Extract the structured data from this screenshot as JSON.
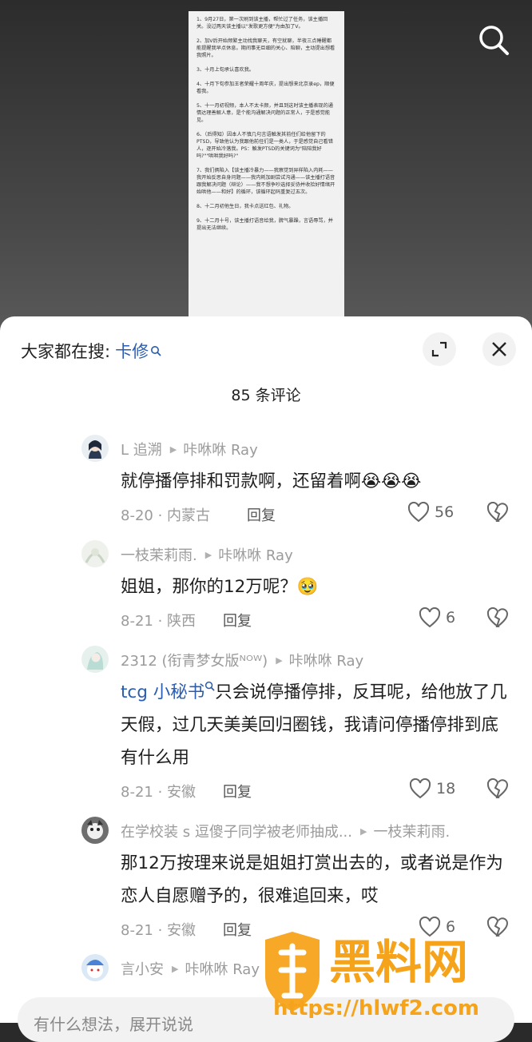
{
  "doc": {
    "paragraphs": [
      "1、9月27日，第一次刷到该主播，帮忙过了任务，该主播回关。没过两天该主播以\"发歌更方便\"为由加了V。",
      "2、加V后开始频繁主动找我聊天，有空就聊，半夜三点睡醒都能提醒我早点休息。期间事无巨细的关心、陪聊，主动提出想看我照片。",
      "3、十月上旬承认喜欢我。",
      "4、十月下旬参加王者荣耀十周年庆，提出想来北京录ep，顺便看我。",
      "5、十一月初视频，本人不太卡颜，并且到这时该主播表现的通情达理善解人意，是个能沟通解决问题的正常人，于是感觉能见。",
      "6、（后得知）因本人不慎几句言语触发其前任们给他留下的PTSD，导致他认为我跟他前任们是一类人，于是感觉自己看错人，逐开始冷落我。PS：触发PTSD的关键词为\"陪陪我好吗?\"\"哄哄我好吗?\"",
      "7、我们俩陷入【该主播冷暴力——我察觉到异样陷入内耗——我开始反思自身问题——我内耗加剧尝试沟通——该主播打语音跟我解决问题（辩论）——我不想争吵选择妥协并收拾好情绪开始哄他——和好】的循环，该循环起码重复过五次。",
      "8、十二月初他生日，我卡点送红包、礼物。",
      "9、十二月十号，该主播打语音给我，脾气暴躁，言语辱骂，并提出无法继续。"
    ]
  },
  "header": {
    "search_prefix": "大家都在搜:",
    "search_keyword": "卡修",
    "comment_count": "85 条评论"
  },
  "comments": [
    {
      "user": "L 追溯",
      "reply_to": "咔咻咻 Ray",
      "text": "就停播停排和罚款啊，还留着啊😭😭😭",
      "date": "8-20 · 内蒙古",
      "reply": "回复",
      "likes": "56"
    },
    {
      "user": "一枝茉莉雨.",
      "reply_to": "咔咻咻 Ray",
      "text": "姐姐，那你的12万呢？🥹",
      "date": "8-21 · 陕西",
      "reply": "回复",
      "likes": "6"
    },
    {
      "user": "2312 (衔青梦女版ᴺᴼᵂ)",
      "reply_to": "咔咻咻 Ray",
      "mention": "tcg 小秘书",
      "text": "只会说停播停排，反耳呢，给他放了几天假，过几天美美回归圈钱，我请问停播停排到底有什么用",
      "date": "8-21 · 安徽",
      "reply": "回复",
      "likes": "18"
    },
    {
      "user": "在学校装 s 逗傻子同学被老师抽成...",
      "reply_to": "一枝茉莉雨.",
      "text": "那12万按理来说是姐姐打赏出去的，或者说是作为恋人自愿赠予的，很难追回来，哎",
      "date": "8-21 · 安徽",
      "reply": "回复",
      "likes": "6"
    },
    {
      "user": "言小安",
      "reply_to": "咔咻咻 Ray"
    }
  ],
  "input": {
    "placeholder": "有什么想法，展开说说"
  },
  "watermark": {
    "brand": "黑料网",
    "url": "https://hlwf2.com"
  },
  "colors": {
    "accent": "#2a5db0",
    "watermark": "#f5a31a"
  }
}
